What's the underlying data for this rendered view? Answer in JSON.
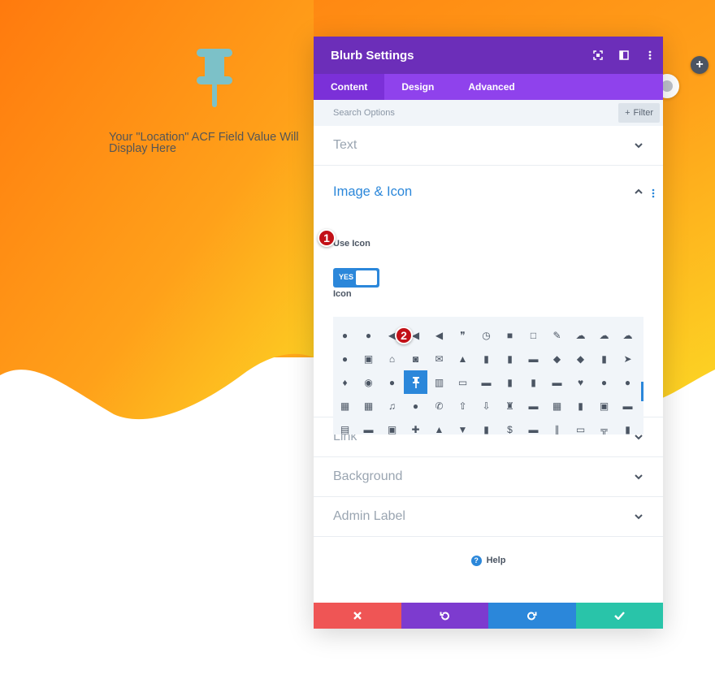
{
  "colors": {
    "gradient_start": "#ff7d0f",
    "gradient_end": "#fcd524",
    "panel_header": "#6c2eb9",
    "tabs_bg": "#8f42ec",
    "accent_blue": "#2b87da",
    "cancel": "#ef5555",
    "undo": "#7d3bcf",
    "redo": "#2b87da",
    "save": "#29c4a9",
    "badge": "#c21017"
  },
  "preview": {
    "icon": "pushpin-icon",
    "text": "Your \"Location\" ACF Field Value Will Display Here"
  },
  "page_controls": {
    "add_icon": "plus-icon",
    "add_symbol": "+"
  },
  "panel": {
    "title": "Blurb Settings",
    "header_icons": [
      "fullscreen-icon",
      "split-view-icon",
      "more-vertical-icon"
    ],
    "tabs": [
      {
        "label": "Content",
        "active": true
      },
      {
        "label": "Design",
        "active": false
      },
      {
        "label": "Advanced",
        "active": false
      }
    ],
    "search_placeholder": "Search Options",
    "filter_label": "Filter",
    "sections": {
      "text": "Text",
      "image_icon": "Image & Icon",
      "link": "Link",
      "background": "Background",
      "admin_label": "Admin Label"
    },
    "use_icon_label": "Use Icon",
    "use_icon_value": "YES",
    "icon_label": "Icon",
    "selected_icon": "pushpin-icon",
    "icon_grid": [
      "chat-bubble-icon",
      "chat-bubbles-icon",
      "mute-icon",
      "volume-low-icon",
      "volume-high-icon",
      "quote-icon",
      "clock-icon",
      "lock-icon",
      "unlock-icon",
      "brush-icon",
      "cloud-icon",
      "cloud-upload-icon",
      "cloud-download-icon",
      "lightbulb-icon",
      "gift-icon",
      "house-icon",
      "camera-icon",
      "mail-icon",
      "cone-icon",
      "bookmark-icon",
      "clipboard-icon",
      "cart-icon",
      "tag-icon",
      "tags-icon",
      "trash-icon",
      "cursor-icon",
      "microphone-icon",
      "compass-icon",
      "map-pin-icon",
      "pushpin-icon",
      "map-icon",
      "inbox-icon",
      "briefcase-icon",
      "book-icon",
      "address-book-icon",
      "archive-icon",
      "heart-icon",
      "person-icon",
      "people-icon",
      "grid-2x2-icon",
      "grid-3x3-icon",
      "music-icon",
      "pause-icon",
      "phone-icon",
      "upload-icon",
      "download-icon",
      "chess-icon",
      "printer-icon",
      "calculator-icon",
      "buildings-icon",
      "save-disk-icon",
      "drive-icon",
      "document-icon",
      "id-card-icon",
      "id-badge-icon",
      "puzzle-icon",
      "thumbs-up-icon",
      "thumbs-down-icon",
      "mug-icon",
      "dollar-icon",
      "wallet-icon",
      "pens-icon",
      "presentation-icon",
      "sitemap-icon",
      "bar-chart-icon"
    ],
    "help_label": "Help",
    "footer": [
      "cancel-icon",
      "undo-icon",
      "redo-icon",
      "save-check-icon"
    ]
  },
  "callouts": [
    "1",
    "2"
  ]
}
